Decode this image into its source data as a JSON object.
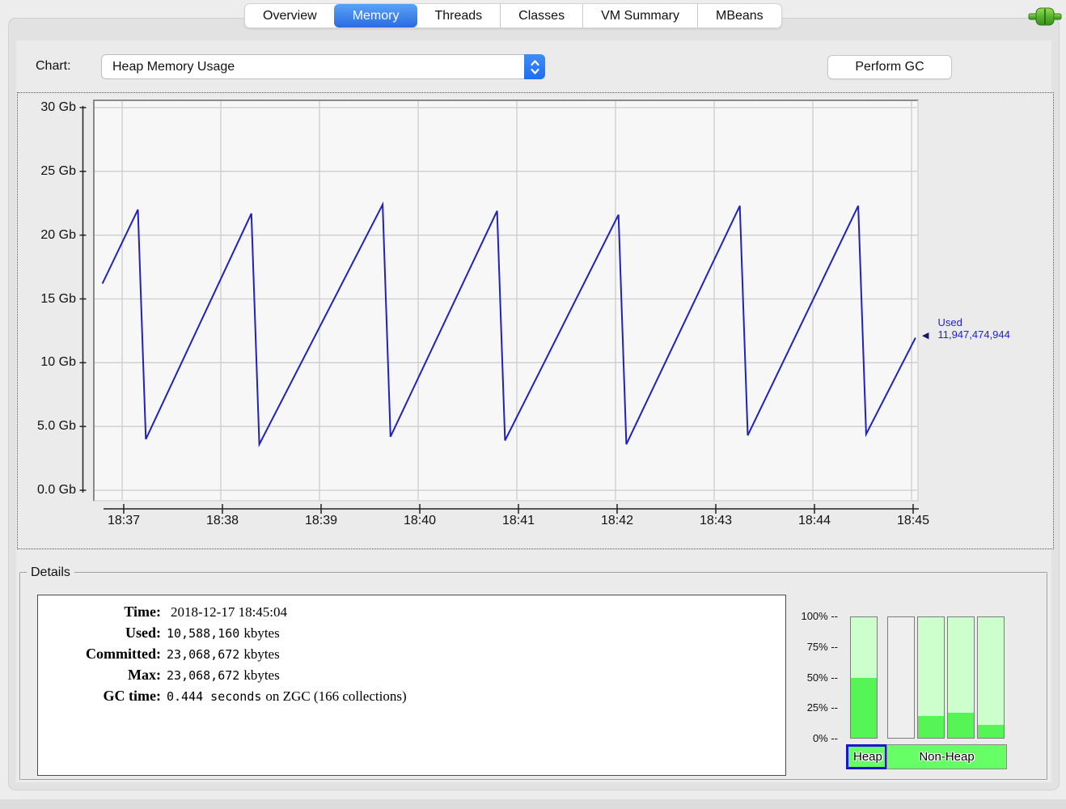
{
  "tabs": {
    "items": [
      {
        "label": "Overview",
        "selected": false
      },
      {
        "label": "Memory",
        "selected": true
      },
      {
        "label": "Threads",
        "selected": false
      },
      {
        "label": "Classes",
        "selected": false
      },
      {
        "label": "VM Summary",
        "selected": false
      },
      {
        "label": "MBeans",
        "selected": false
      }
    ]
  },
  "toolbar": {
    "chart_label": "Chart:",
    "chart_value": "Heap Memory Usage",
    "gc_button": "Perform GC"
  },
  "chart_data": {
    "type": "line",
    "series_name": "Heap Memory Usage",
    "line_color": "#2121bd",
    "grid_color": "#cccccc",
    "plot_bg": "#f7f7f7",
    "y_ticks": [
      "30 Gb",
      "25 Gb",
      "20 Gb",
      "15 Gb",
      "10 Gb",
      "5.0 Gb",
      "0.0 Gb"
    ],
    "y_tick_gb": [
      30,
      25,
      20,
      15,
      10,
      5,
      0
    ],
    "y_range_gb": [
      0,
      30
    ],
    "x_ticks": [
      "18:37",
      "18:38",
      "18:39",
      "18:40",
      "18:41",
      "18:42",
      "18:43",
      "18:44",
      "18:45"
    ],
    "points_t_gb": [
      [
        0.8,
        16.2
      ],
      [
        1.16,
        22.0
      ],
      [
        1.24,
        4.0
      ],
      [
        2.31,
        21.7
      ],
      [
        2.39,
        3.6
      ],
      [
        3.64,
        22.4
      ],
      [
        3.72,
        4.2
      ],
      [
        4.8,
        21.9
      ],
      [
        4.88,
        3.9
      ],
      [
        6.03,
        21.6
      ],
      [
        6.11,
        3.6
      ],
      [
        7.26,
        22.3
      ],
      [
        7.34,
        4.3
      ],
      [
        8.46,
        22.3
      ],
      [
        8.54,
        4.4
      ],
      [
        9.04,
        11.95
      ]
    ],
    "annotation": {
      "label": "Used",
      "value": "11,947,474,944",
      "pointer": "◀"
    }
  },
  "details": {
    "title": "Details",
    "rows": [
      {
        "label": "Time:",
        "num": "",
        "text": "2018-12-17 18:45:04"
      },
      {
        "label": "Used:",
        "num": "10,588,160",
        "text": "kbytes"
      },
      {
        "label": "Committed:",
        "num": "23,068,672",
        "text": "kbytes"
      },
      {
        "label": "Max:",
        "num": "23,068,672",
        "text": "kbytes"
      },
      {
        "label": "GC time:",
        "num": "0.444 seconds",
        "text": "on ZGC (166 collections)"
      }
    ]
  },
  "usage_bars": {
    "scale": [
      "100% --",
      "75% --",
      "50% --",
      "25% --",
      "0% --"
    ],
    "bars": [
      {
        "name": "heap",
        "fill_pct": 50,
        "empty": false
      },
      {
        "name": "non-heap-pool-1",
        "fill_pct": 0,
        "empty": true
      },
      {
        "name": "non-heap-pool-2",
        "fill_pct": 18,
        "empty": false
      },
      {
        "name": "non-heap-pool-3",
        "fill_pct": 21,
        "empty": false
      },
      {
        "name": "non-heap-pool-4",
        "fill_pct": 11,
        "empty": false
      }
    ],
    "heap_button": "Heap",
    "nonheap_button": "Non-Heap",
    "colors": {
      "committed": "#ccffcc",
      "used": "#55f555",
      "button_green": "#66ff66"
    }
  }
}
